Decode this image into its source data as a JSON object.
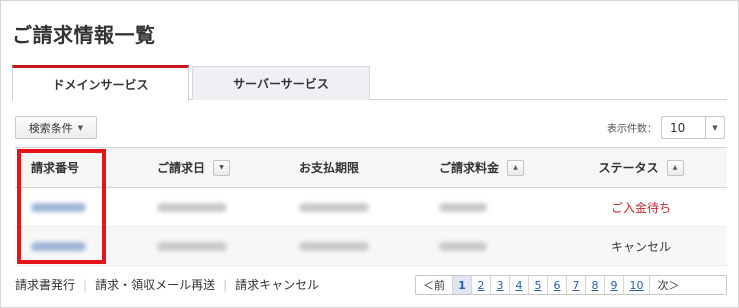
{
  "page_title": "ご請求情報一覧",
  "tabs": [
    {
      "label": "ドメインサービス",
      "active": true
    },
    {
      "label": "サーバーサービス",
      "active": false
    }
  ],
  "filter": {
    "label": "検索条件"
  },
  "display_count": {
    "label": "表示件数：",
    "value": "10"
  },
  "table": {
    "headers": {
      "invoice_no": "請求番号",
      "invoice_date": "ご請求日",
      "due_date": "お支払期限",
      "amount": "ご請求料金",
      "status": "ステータス"
    },
    "rows": [
      {
        "status": "ご入金待ち"
      },
      {
        "status": "キャンセル"
      }
    ]
  },
  "footer_links": [
    "請求書発行",
    "請求・領収メール再送",
    "請求キャンセル"
  ],
  "pagination": {
    "prev": "＜前",
    "next": "次＞",
    "pages": [
      "1",
      "2",
      "3",
      "4",
      "5",
      "6",
      "7",
      "8",
      "9",
      "10"
    ],
    "current": "1"
  },
  "colors": {
    "tab_accent": "#c8161d",
    "status_awaiting": "#c0282e",
    "link": "#2a5db0",
    "highlight_box": "#e5141a"
  }
}
